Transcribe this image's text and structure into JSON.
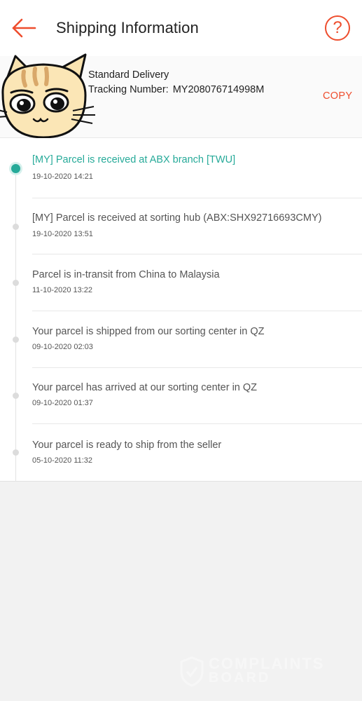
{
  "header": {
    "title": "Shipping Information",
    "back_icon": "arrow-left-icon",
    "help_icon": "question-circle-icon",
    "help_glyph": "?"
  },
  "delivery": {
    "type": "Standard Delivery",
    "tracking_label": "Tracking Number:",
    "tracking_number": "MY208076714998M",
    "copy_label": "COPY"
  },
  "events": [
    {
      "description": "[MY] Parcel is received at ABX branch [TWU]",
      "time": "19-10-2020 14:21",
      "active": true
    },
    {
      "description": "[MY] Parcel is received at sorting hub (ABX:SHX92716693CMY)",
      "time": "19-10-2020 13:51",
      "active": false
    },
    {
      "description": "Parcel is in-transit from China to Malaysia",
      "time": "11-10-2020 13:22",
      "active": false
    },
    {
      "description": "Your parcel is shipped from our sorting center in QZ",
      "time": "09-10-2020 02:03",
      "active": false
    },
    {
      "description": "Your parcel has arrived at our sorting center in QZ",
      "time": "09-10-2020 01:37",
      "active": false
    },
    {
      "description": "Your parcel is ready to ship from the seller",
      "time": "05-10-2020 11:32",
      "active": false
    }
  ],
  "watermark": {
    "line1": "COMPLAINTS",
    "line2": "BOARD"
  },
  "colors": {
    "accent": "#ee4d2d",
    "active_status": "#26aa99"
  }
}
